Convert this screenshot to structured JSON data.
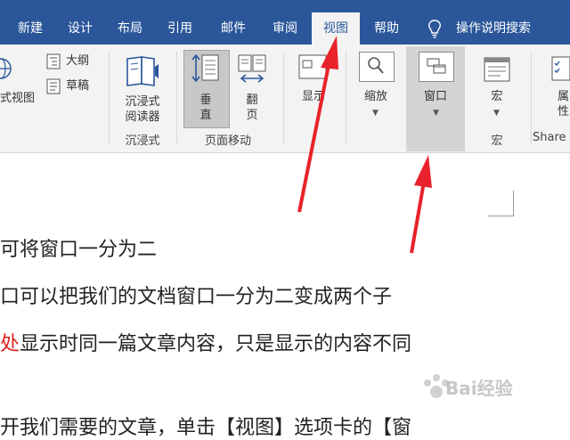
{
  "tabs": [
    "新建",
    "设计",
    "布局",
    "引用",
    "邮件",
    "审阅",
    "视图",
    "帮助"
  ],
  "active_tab": "视图",
  "search_label": "操作说明搜索",
  "ribbon": {
    "view_partial": "式视图",
    "outline": "大纲",
    "draft": "草稿",
    "immersive_reader": [
      "沉浸式",
      "阅读器"
    ],
    "group_immersive": "沉浸式",
    "vertical": [
      "垂",
      "直"
    ],
    "flip": [
      "翻",
      "页"
    ],
    "group_page_move": "页面移动",
    "show": "显示",
    "zoom": "缩放",
    "window": "窗口",
    "macro": "宏",
    "group_macro": "宏",
    "property_partial": [
      "属",
      "性"
    ],
    "group_share": "Share"
  },
  "document": {
    "line1": "可将窗口一分为二",
    "line2": "口可以把我们的文档窗口一分为二变成两个子",
    "line3_red": "处",
    "line3_rest": "显示时同一篇文章内容，只是显示的内容不同",
    "line4": "开我们需要的文章，单击【视图】选项卡的【窗"
  },
  "watermark": "Bai经验",
  "colors": {
    "accent": "#2b579a",
    "ribbon_bg": "#f3f3f3",
    "arrow": "#e8222a"
  }
}
